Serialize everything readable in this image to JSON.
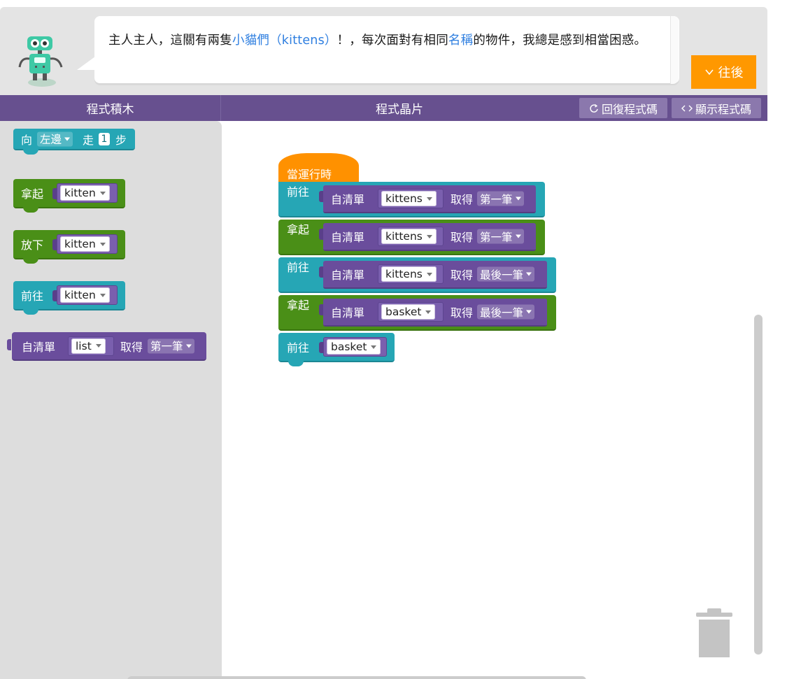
{
  "header": {
    "message_parts": [
      {
        "text": "主人主人，這關有兩隻",
        "highlight": false
      },
      {
        "text": "小貓們（kittens）",
        "highlight": true
      },
      {
        "text": "！，每次面對有相同",
        "highlight": false
      },
      {
        "text": "名稱",
        "highlight": true
      },
      {
        "text": "的物件，我總是感到相當困惑。",
        "highlight": false
      }
    ],
    "next_label": "往後",
    "avatar": "robot-avatar"
  },
  "tabs": {
    "blocks_label": "程式積木",
    "workspace_label": "程式晶片",
    "reset_label": "回復程式碼",
    "show_code_label": "顯示程式碼"
  },
  "toolbox": {
    "move_block": {
      "prefix": "向",
      "direction": "左邊",
      "verb": "走",
      "steps": "1",
      "unit": "步"
    },
    "pickup_block": {
      "label": "拿起",
      "item": "kitten"
    },
    "putdown_block": {
      "label": "放下",
      "item": "kitten"
    },
    "goto_block": {
      "label": "前往",
      "item": "kitten"
    },
    "list_block": {
      "label": "自清單",
      "list": "list",
      "get": "取得",
      "which": "第一筆"
    }
  },
  "program": {
    "start_label": "當運行時",
    "steps": [
      {
        "action": "前往",
        "from": "自清單",
        "list": "kittens",
        "get": "取得",
        "which": "第一筆"
      },
      {
        "action": "拿起",
        "from": "自清單",
        "list": "kittens",
        "get": "取得",
        "which": "第一筆"
      },
      {
        "action": "前往",
        "from": "自清單",
        "list": "kittens",
        "get": "取得",
        "which": "最後一筆"
      },
      {
        "action": "拿起",
        "from": "自清單",
        "list": "basket",
        "get": "取得",
        "which": "最後一筆"
      },
      {
        "action": "前往",
        "item": "basket"
      }
    ]
  },
  "colors": {
    "purple_bar": "#67508f",
    "teal_block": "#26a6b5",
    "green_block": "#4a8f17",
    "purple_block": "#6a4d9c",
    "orange": "#ff9100"
  }
}
